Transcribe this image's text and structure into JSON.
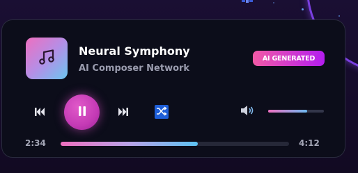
{
  "track": {
    "title": "Neural Symphony",
    "artist": "AI Composer Network",
    "badge": "AI GENERATED",
    "cover_icon": "music-note-icon"
  },
  "playback": {
    "current_time": "2:34",
    "total_time": "4:12",
    "progress": 0.6,
    "state": "playing",
    "volume": 0.7
  },
  "controls": {
    "previous_icon": "skip-previous-icon",
    "play_pause_icon": "pause-icon",
    "next_icon": "skip-next-icon",
    "shuffle_icon": "shuffle-icon",
    "volume_icon": "speaker-icon"
  },
  "colors": {
    "accent_pink": "#ee6fbf",
    "accent_purple": "#b41df0",
    "accent_blue": "#5cc2f2",
    "card_background": "#0c0d1a",
    "page_background": "#140b26"
  }
}
